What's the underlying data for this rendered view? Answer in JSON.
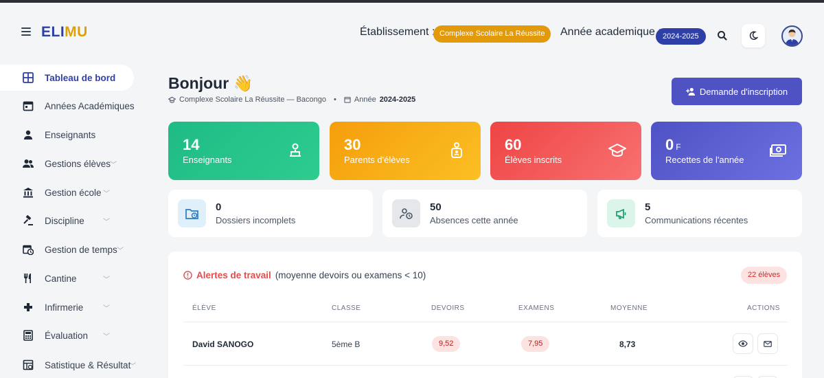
{
  "header": {
    "logo_part1": "ELI",
    "logo_part2": "MU",
    "etablissement_label": "Établissement :",
    "etablissement_value": "Complexe Scolaire La Réussite",
    "annee_label": "Année academique :",
    "annee_value": "2024-2025",
    "icons": [
      "menu-icon",
      "search-icon",
      "moon-icon",
      "avatar"
    ]
  },
  "sidebar": {
    "items": [
      {
        "label": "Tableau de bord",
        "icon": "dashboard-icon",
        "active": true
      },
      {
        "label": "Années Académiques",
        "icon": "calendar-icon"
      },
      {
        "label": "Enseignants",
        "icon": "person-icon"
      },
      {
        "label": "Gestions élèves",
        "icon": "group-icon",
        "has_chevron": true
      },
      {
        "label": "Gestion école",
        "icon": "bank-icon",
        "has_chevron": true
      },
      {
        "label": "Discipline",
        "icon": "gavel-icon",
        "has_chevron": true
      },
      {
        "label": "Gestion de temps",
        "icon": "calendar-clock-icon",
        "has_chevron": true
      },
      {
        "label": "Cantine",
        "icon": "utensils-icon",
        "has_chevron": true
      },
      {
        "label": "Infirmerie",
        "icon": "medical-cross-icon",
        "has_chevron": true
      },
      {
        "label": "Évaluation",
        "icon": "calculator-icon",
        "has_chevron": true
      },
      {
        "label": "Satistique & Résultat",
        "icon": "stats-icon",
        "has_chevron": true
      }
    ]
  },
  "greeting": {
    "title": "Bonjour 👋",
    "school": "Complexe Scolaire La Réussite — Bacongo",
    "separator": "•",
    "annee_prefix": "Année",
    "annee_value": "2024-2025"
  },
  "demande_button": "Demande d'inscription",
  "stats": [
    {
      "value": "14",
      "unit": "",
      "label": "Enseignants",
      "icon": "teacher-icon",
      "color": "#22b983"
    },
    {
      "value": "30",
      "unit": "",
      "label": "Parents d'élèves",
      "icon": "parent-icon",
      "color": "#f5a623"
    },
    {
      "value": "60",
      "unit": "",
      "label": "Élèves inscrits",
      "icon": "graduation-cap-icon",
      "color": "#ef4444"
    },
    {
      "value": "0",
      "unit": "F",
      "label": "Recettes de l'année",
      "icon": "money-icon",
      "color": "#5b5fd6"
    }
  ],
  "mini_stats": [
    {
      "value": "0",
      "label": "Dossiers incomplets",
      "icon": "folder-clock-icon"
    },
    {
      "value": "50",
      "label": "Absences cette année",
      "icon": "person-clock-icon"
    },
    {
      "value": "5",
      "label": "Communications récentes",
      "icon": "megaphone-icon"
    }
  ],
  "alerts": {
    "title": "Alertes de travail",
    "subtitle": "(moyenne devoirs ou examens < 10)",
    "count": "22 élèves",
    "columns": [
      "ÉLÈVE",
      "CLASSE",
      "DEVOIRS",
      "EXAMENS",
      "MOYENNE",
      "ACTIONS"
    ],
    "rows": [
      {
        "eleve": "David SANOGO",
        "classe": "5ème B",
        "devoirs": "9,52",
        "examens": "7,95",
        "moyenne": "8,73"
      }
    ]
  }
}
